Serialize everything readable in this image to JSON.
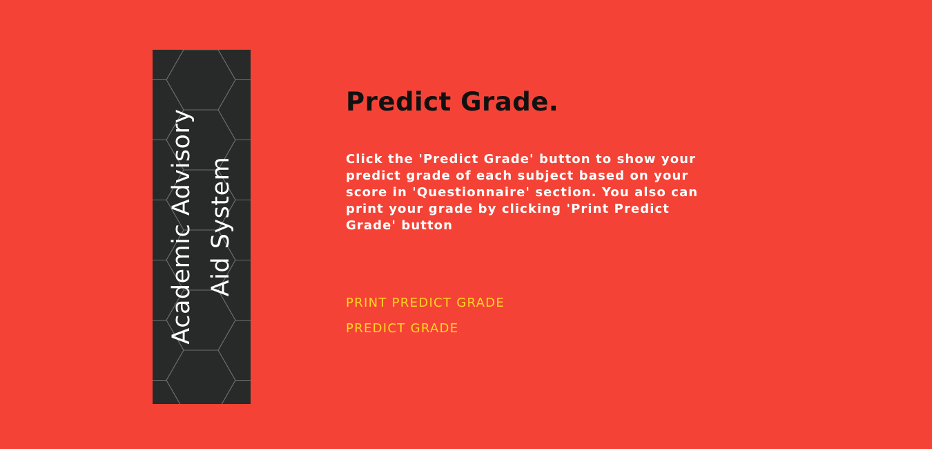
{
  "banner": {
    "title_line1": "Academic Advisory",
    "title_line2": "Aid System"
  },
  "main": {
    "heading": "Predict Grade.",
    "description": "Click the 'Predict Grade' button to show your predict grade of each subject based on your score in 'Questionnaire' section. You also can print your grade by clicking 'Print Predict Grade' button",
    "print_button_label": "PRINT PREDICT GRADE",
    "predict_button_label": "PREDICT GRADE"
  },
  "colors": {
    "background": "#f44336",
    "banner": "#282a29",
    "heading": "#111111",
    "description": "#ffffff",
    "action_link": "#ffd71f",
    "hex_pattern": "#6e706f"
  }
}
